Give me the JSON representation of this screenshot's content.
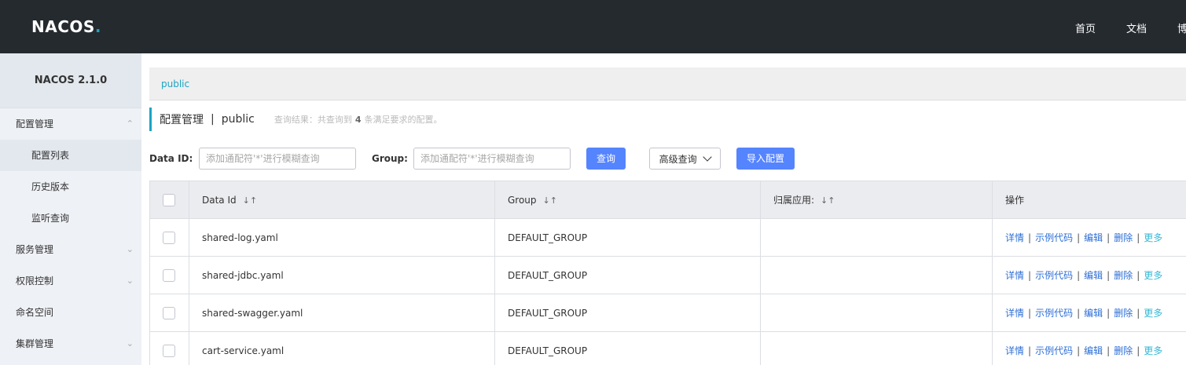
{
  "header": {
    "logo_a": "NA",
    "logo_b": "C",
    "logo_c": "OS",
    "logo_dot": ".",
    "nav": [
      "首页",
      "文档",
      "博"
    ]
  },
  "sidebar": {
    "version": "NACOS 2.1.0",
    "items": [
      {
        "label": "配置管理",
        "chevron": "⌃"
      },
      {
        "label": "配置列表"
      },
      {
        "label": "历史版本"
      },
      {
        "label": "监听查询"
      },
      {
        "label": "服务管理",
        "chevron": "⌄"
      },
      {
        "label": "权限控制",
        "chevron": "⌄"
      },
      {
        "label": "命名空间"
      },
      {
        "label": "集群管理",
        "chevron": "⌄"
      }
    ]
  },
  "namespace_bar": {
    "label": "public"
  },
  "title": {
    "main": "配置管理",
    "sep": "|",
    "ns": "public",
    "result_prefix": "查询结果：共查询到",
    "result_count": "4",
    "result_suffix": "条满足要求的配置。"
  },
  "search": {
    "dataid_label": "Data ID:",
    "dataid_placeholder": "添加通配符'*'进行模糊查询",
    "group_label": "Group:",
    "group_placeholder": "添加通配符'*'进行模糊查询",
    "query_btn": "查询",
    "advanced_btn": "高级查询",
    "import_btn": "导入配置"
  },
  "table": {
    "headers": [
      "Data Id",
      "Group",
      "归属应用:",
      "操作"
    ],
    "sort_icon": "↓↑",
    "rows": [
      {
        "data_id": "shared-log.yaml",
        "group": "DEFAULT_GROUP",
        "app": ""
      },
      {
        "data_id": "shared-jdbc.yaml",
        "group": "DEFAULT_GROUP",
        "app": ""
      },
      {
        "data_id": "shared-swagger.yaml",
        "group": "DEFAULT_GROUP",
        "app": ""
      },
      {
        "data_id": "cart-service.yaml",
        "group": "DEFAULT_GROUP",
        "app": ""
      }
    ],
    "ops": {
      "detail": "详情",
      "sample": "示例代码",
      "edit": "编辑",
      "delete": "删除",
      "more": "更多",
      "bar": "|"
    }
  },
  "colors": {
    "topbar": "#252a2f",
    "accent": "#1ba4c2",
    "primary_btn": "#5584ff",
    "link": "#2e6fd6"
  }
}
